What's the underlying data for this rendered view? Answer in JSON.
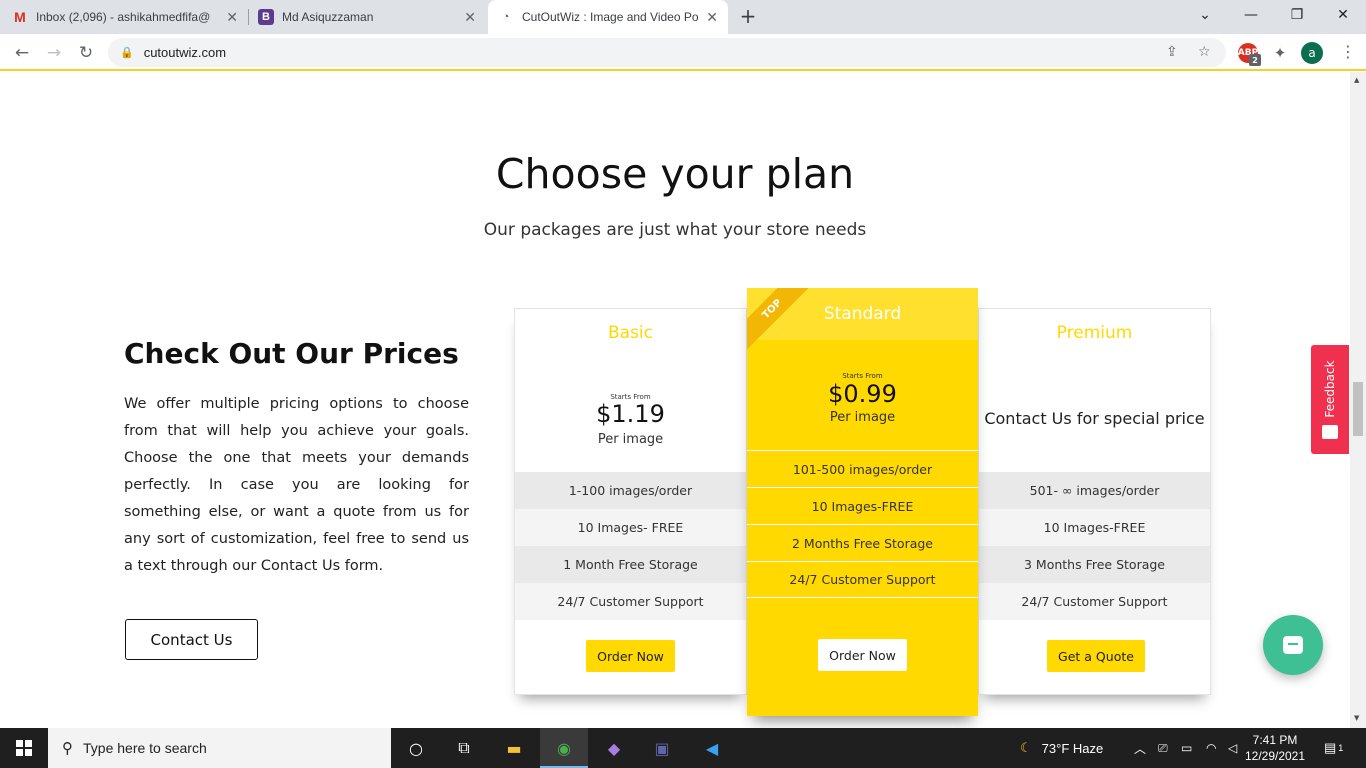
{
  "browser": {
    "tabs": [
      {
        "title": "Inbox (2,096) - ashikahmedfifa@",
        "icon": "gmail-icon"
      },
      {
        "title": "Md Asiquzzaman",
        "icon": "b-icon"
      },
      {
        "title": "CutOutWiz : Image and Video Po",
        "icon": "cutoutwiz-icon"
      }
    ],
    "url": "cutoutwiz.com",
    "profile_initial": "a",
    "ext_badge": "2",
    "ext_label": "ABP"
  },
  "page": {
    "heading": "Choose your plan",
    "subheading": "Our packages are just what your store needs",
    "left": {
      "title": "Check Out Our Prices",
      "text": "We offer multiple pricing options to choose from that will help you achieve your goals. Choose the one that meets your demands perfectly. In case you are looking for something else, or want a quote from us for any sort of customization, feel free to send us a text through our Contact Us form.",
      "button": "Contact Us"
    },
    "plans": {
      "basic": {
        "name": "Basic",
        "starts": "Starts From",
        "price": "$1.19",
        "per": "Per image",
        "features": [
          "1-100 images/order",
          "10 Images- FREE",
          "1 Month Free Storage",
          "24/7 Customer Support"
        ],
        "button": "Order Now"
      },
      "standard": {
        "name": "Standard",
        "ribbon": "TOP",
        "starts": "Starts From",
        "price": "$0.99",
        "per": "Per image",
        "features": [
          "101-500 images/order",
          "10 Images-FREE",
          "2 Months Free Storage",
          "24/7 Customer Support"
        ],
        "button": "Order Now"
      },
      "premium": {
        "name": "Premium",
        "special": "Contact Us for special price",
        "features": [
          "501- ∞ images/order",
          "10 Images-FREE",
          "3 Months Free Storage",
          "24/7 Customer Support"
        ],
        "button": "Get a Quote"
      }
    },
    "feedback": "Feedback"
  },
  "taskbar": {
    "search_placeholder": "Type here to search",
    "weather": "73°F  Haze",
    "time": "7:41 PM",
    "date": "12/29/2021",
    "notifications": "1"
  },
  "colors": {
    "accent": "#ffd900",
    "feedback": "#f0304f",
    "chat": "#3fbf94"
  }
}
